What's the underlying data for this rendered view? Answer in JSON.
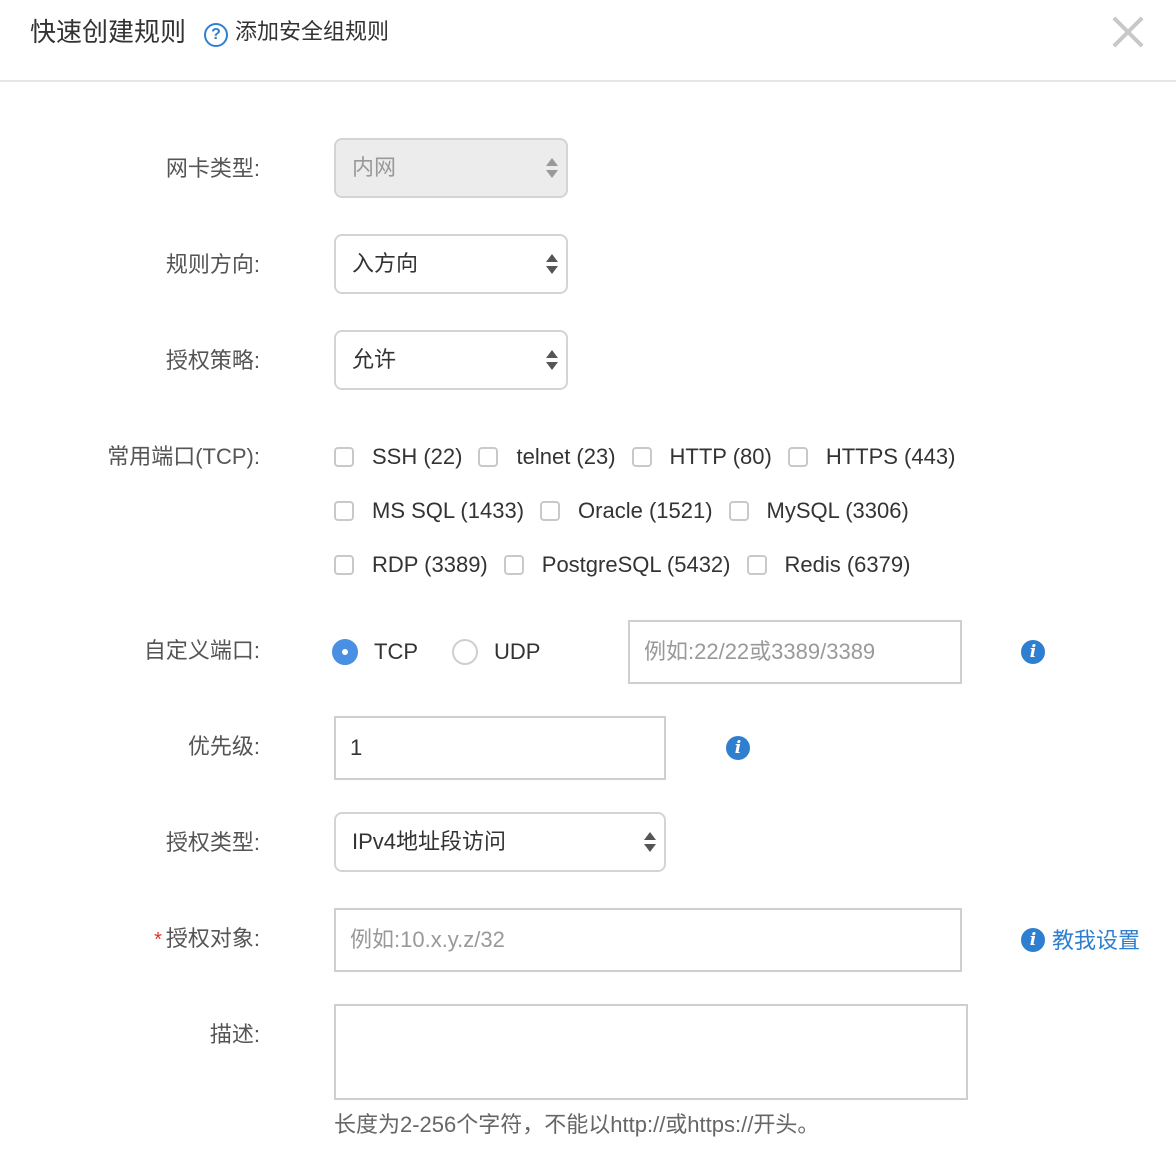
{
  "header": {
    "title": "快速创建规则",
    "help_icon": "question-circle-icon",
    "subtitle": "添加安全组规则",
    "close_icon": "close-icon"
  },
  "form": {
    "nic_type": {
      "label": "网卡类型:",
      "value": "内网",
      "disabled": true
    },
    "direction": {
      "label": "规则方向:",
      "value": "入方向"
    },
    "policy": {
      "label": "授权策略:",
      "value": "允许"
    },
    "common_ports": {
      "label": "常用端口(TCP):",
      "rows": [
        [
          {
            "label": "SSH (22)",
            "checked": false
          },
          {
            "label": "telnet (23)",
            "checked": false
          },
          {
            "label": "HTTP (80)",
            "checked": false
          },
          {
            "label": "HTTPS (443)",
            "checked": false
          }
        ],
        [
          {
            "label": "MS SQL (1433)",
            "checked": false
          },
          {
            "label": "Oracle (1521)",
            "checked": false
          },
          {
            "label": "MySQL (3306)",
            "checked": false
          }
        ],
        [
          {
            "label": "RDP (3389)",
            "checked": false
          },
          {
            "label": "PostgreSQL (5432)",
            "checked": false
          },
          {
            "label": "Redis (6379)",
            "checked": false
          }
        ]
      ]
    },
    "custom_port": {
      "label": "自定义端口:",
      "protocols": [
        {
          "label": "TCP",
          "checked": true
        },
        {
          "label": "UDP",
          "checked": false
        }
      ],
      "placeholder": "例如:22/22或3389/3389",
      "value": "",
      "info_icon": "info-icon"
    },
    "priority": {
      "label": "优先级:",
      "value": "1",
      "info_icon": "info-icon"
    },
    "auth_type": {
      "label": "授权类型:",
      "value": "IPv4地址段访问"
    },
    "auth_object": {
      "required_mark": "*",
      "label": "授权对象:",
      "placeholder": "例如:10.x.y.z/32",
      "value": "",
      "help_link": "教我设置",
      "info_icon": "info-icon"
    },
    "description": {
      "label": "描述:",
      "value": "",
      "hint": "长度为2-256个字符，不能以http://或https://开头。"
    }
  },
  "colors": {
    "accent": "#2f7fd1",
    "radio_checked": "#4a90e2",
    "required": "#e0322b",
    "label_text": "#555555",
    "placeholder": "#999999"
  }
}
